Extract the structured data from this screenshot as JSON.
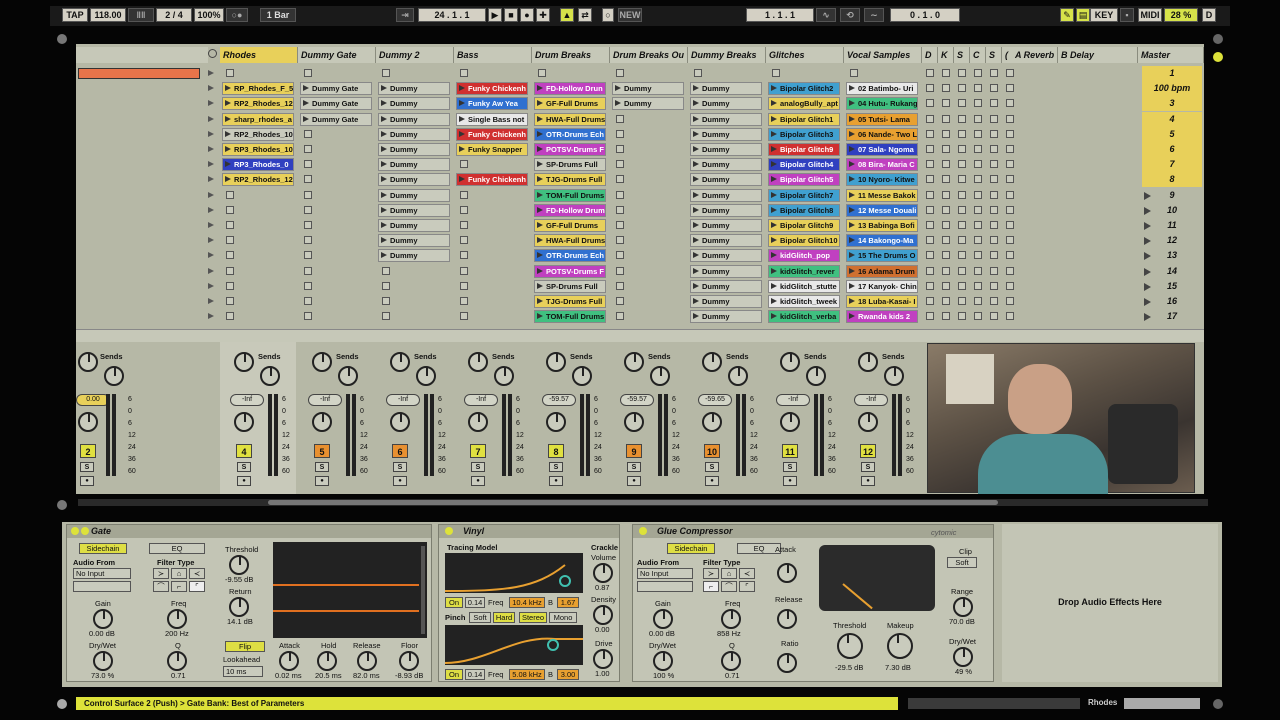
{
  "transport": {
    "tap": "TAP",
    "tempo": "118.00",
    "sig": "2 / 4",
    "zoom": "100%",
    "quant": "1 Bar",
    "position": "24 . 1 . 1",
    "new": "NEW",
    "loop_start": "1 . 1 . 1",
    "loop_len": "0 . 1 . 0",
    "key": "KEY",
    "midi": "MIDI",
    "cpu": "28 %",
    "d": "D"
  },
  "tracks": [
    {
      "name": "Rhodes",
      "color": "#e8d05a"
    },
    {
      "name": "Dummy Gate",
      "color": "#c6c8b8"
    },
    {
      "name": "Dummy 2",
      "color": "#c6c8b8"
    },
    {
      "name": "Bass",
      "color": "#c6c8b8"
    },
    {
      "name": "Drum Breaks",
      "color": "#c6c8b8"
    },
    {
      "name": "Drum Breaks Ou",
      "color": "#c6c8b8"
    },
    {
      "name": "Dummy Breaks",
      "color": "#c6c8b8"
    },
    {
      "name": "Glitches",
      "color": "#c6c8b8"
    },
    {
      "name": "Vocal Samples",
      "color": "#c6c8b8"
    }
  ],
  "small_headers": [
    "D",
    "K",
    "S",
    "C",
    "S",
    "("
  ],
  "returns": [
    {
      "name": "A Reverb"
    },
    {
      "name": "B Delay"
    }
  ],
  "master": {
    "name": "Master"
  },
  "scenes": [
    "1",
    "100 bpm",
    "3",
    "4",
    "5",
    "6",
    "7",
    "8",
    "9",
    "10",
    "11",
    "12",
    "13",
    "14",
    "15",
    "16",
    "17"
  ],
  "clips": {
    "rhodes": [
      "RP_Rhodes_F_5",
      "RP2_Rhodes_12",
      "sharp_rhodes_a",
      "RP2_Rhodes_10",
      "RP3_Rhodes_10",
      "RP3_Rhodes_0",
      "RP2_Rhodes_12"
    ],
    "gate": [
      "Dummy Gate",
      "Dummy Gate",
      "Dummy Gate"
    ],
    "dummy2": [
      "Dummy",
      "Dummy",
      "Dummy",
      "Dummy",
      "Dummy",
      "Dummy",
      "Dummy",
      "Dummy",
      "Dummy",
      "Dummy",
      "Dummy",
      "Dummy"
    ],
    "bass": [
      "Funky Chickenh",
      "Funky Aw Yea",
      "Single Bass not",
      "Funky Chickenh",
      "Funky Snapper",
      "",
      "Funky Chickenh"
    ],
    "drumbreaks": [
      "FD-Hollow Drun",
      "GF-Full Drums",
      "HWA-Full Drums",
      "OTR-Drums Ech",
      "POTSV-Drums F",
      "SP-Drums Full",
      "TJG-Drums Full",
      "TOM-Full Drums",
      "FD-Hollow Drum",
      "GF-Full Drums",
      "HWA-Full Drums",
      "OTR-Drums Ech",
      "POTSV-Drums F",
      "SP-Drums Full",
      "TJG-Drums Full",
      "TOM-Full Drums"
    ],
    "drumout": [
      "Dummy",
      "Dummy"
    ],
    "dummybreaks": [
      "Dummy",
      "Dummy",
      "Dummy",
      "Dummy",
      "Dummy",
      "Dummy",
      "Dummy",
      "Dummy",
      "Dummy",
      "Dummy",
      "Dummy",
      "Dummy",
      "Dummy",
      "Dummy",
      "Dummy",
      "Dummy"
    ],
    "glitches": [
      "Bipolar Glitch2",
      "analogBully_apt",
      "Bipolar Glitch1",
      "Bipolar Glitch3",
      "Bipolar Glitch9",
      "Bipolar Glitch4",
      "Bipolar Glitch5",
      "Bipolar Glitch7",
      "Bipolar Glitch8",
      "Bipolar Glitch9",
      "Bipolar Glitch10",
      "kidGlitch_pop",
      "kidGlitch_rever",
      "kidGlitch_stutte",
      "kidGlitch_tweek",
      "kidGlitch_verba"
    ],
    "vocals": [
      "02 Batimbo- Uri",
      "04 Hutu- Rukang",
      "05 Tutsi- Lama",
      "06 Nande- Two L",
      "07 Sala- Ngoma",
      "08 Bira- Maria C",
      "10 Nyoro- Kitwe",
      "11 Messe Bakok",
      "12 Messe Douali",
      "13 Babinga Bofi",
      "14 Bakongo-Ma",
      "15 The Drums O",
      "16 Adama Drum",
      "17 Kanyok- Chin",
      "18 Luba-Kasai- I",
      "Rwanda kids 2"
    ]
  },
  "mixer": {
    "sends": "Sends",
    "strips": [
      {
        "vol": "0.00",
        "num": "2",
        "numcolor": "#e0e040"
      },
      {
        "vol": "-Inf",
        "num": "4",
        "numcolor": "#e0e040"
      },
      {
        "vol": "-Inf",
        "num": "5",
        "numcolor": "#e89030"
      },
      {
        "vol": "-Inf",
        "num": "6",
        "numcolor": "#e89030"
      },
      {
        "vol": "-Inf",
        "num": "7",
        "numcolor": "#e0e040"
      },
      {
        "vol": "-59.57",
        "num": "8",
        "numcolor": "#e0e040"
      },
      {
        "vol": "-59.57",
        "num": "9",
        "numcolor": "#e89030"
      },
      {
        "vol": "-59.65",
        "num": "10",
        "numcolor": "#e89030"
      },
      {
        "vol": "-Inf",
        "num": "11",
        "numcolor": "#e0e040"
      },
      {
        "vol": "-Inf",
        "num": "12",
        "numcolor": "#e0e040"
      }
    ],
    "scale": [
      "6",
      "0",
      "6",
      "12",
      "24",
      "36",
      "60"
    ],
    "solo": "S"
  },
  "devices": {
    "gate": {
      "title": "Gate",
      "sidechain": "Sidechain",
      "eq": "EQ",
      "audio_from": "Audio From",
      "no_input": "No Input",
      "filter_type": "Filter Type",
      "gain_label": "Gain",
      "gain_val": "0.00 dB",
      "freq_label": "Freq",
      "freq_val": "200 Hz",
      "drywet_label": "Dry/Wet",
      "drywet_val": "73.0 %",
      "q_label": "Q",
      "q_val": "0.71",
      "threshold_label": "Threshold",
      "threshold_val": "-9.55 dB",
      "return_label": "Return",
      "return_val": "14.1 dB",
      "flip": "Flip",
      "lookahead": "Lookahead",
      "lookahead_val": "10 ms",
      "attack_label": "Attack",
      "attack_val": "0.02 ms",
      "hold_label": "Hold",
      "hold_val": "20.5 ms",
      "release_label": "Release",
      "release_val": "82.0 ms",
      "floor_label": "Floor",
      "floor_val": "-8.93 dB"
    },
    "vinyl": {
      "title": "Vinyl",
      "tracing": "Tracing Model",
      "crackle": "Crackle",
      "volume": "Volume",
      "volume_val": "0.87",
      "density": "Density",
      "density_val": "0.00",
      "drive": "Drive",
      "drive_val": "1.00",
      "on1": "On",
      "v1": "0.14",
      "freq": "Freq",
      "f1": "10.4 kHz",
      "b": "B",
      "b1": "1.67",
      "pinch": "Pinch",
      "soft": "Soft",
      "hard": "Hard",
      "stereo": "Stereo",
      "mono": "Mono",
      "on2": "On",
      "v2": "0.14",
      "f2": "5.08 kHz",
      "b2": "3.00"
    },
    "glue": {
      "title": "Glue Compressor",
      "brand": "cytomic",
      "sidechain": "Sidechain",
      "eq": "EQ",
      "audio_from": "Audio From",
      "no_input": "No Input",
      "filter_type": "Filter Type",
      "gain_label": "Gain",
      "gain_val": "0.00 dB",
      "freq_label": "Freq",
      "freq_val": "858 Hz",
      "drywet_label": "Dry/Wet",
      "drywet_val": "100 %",
      "q_label": "Q",
      "q_val": "0.71",
      "attack_label": "Attack",
      "release_label": "Release",
      "ratio_label": "Ratio",
      "threshold_label": "Threshold",
      "threshold_val": "-29.5 dB",
      "makeup_label": "Makeup",
      "makeup_val": "7.30 dB",
      "clip_label": "Clip",
      "soft": "Soft",
      "range_label": "Range",
      "range_val": "70.0 dB",
      "drywet2_label": "Dry/Wet",
      "drywet2_val": "49 %"
    },
    "drop": "Drop Audio Effects Here"
  },
  "status": {
    "text": "Control Surface 2 (Push) > Gate Bank: Best of Parameters",
    "track": "Rhodes"
  }
}
